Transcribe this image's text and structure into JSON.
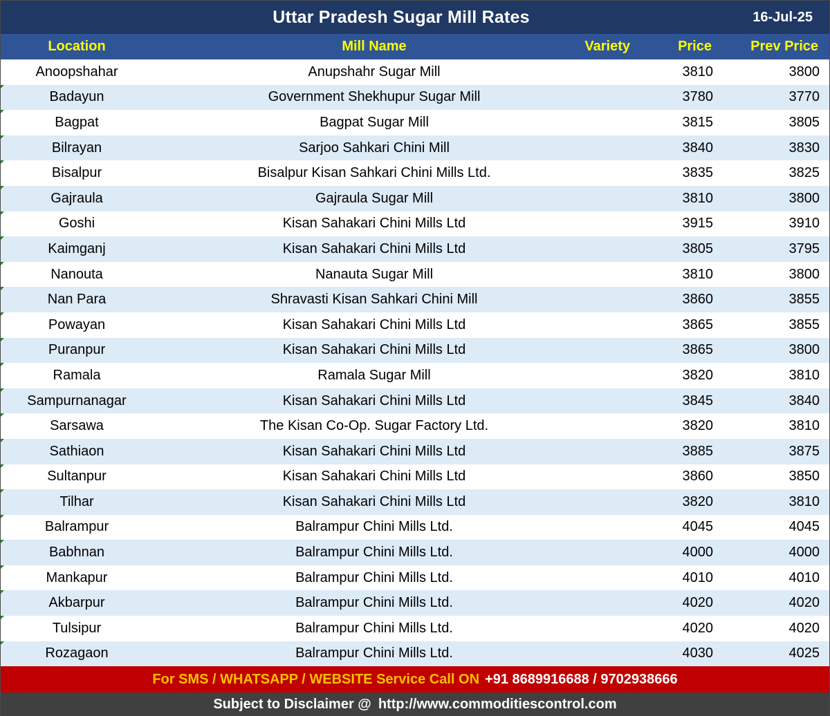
{
  "title": "Uttar Pradesh Sugar Mill Rates",
  "date": "16-Jul-25",
  "columns": {
    "location": "Location",
    "mill_name": "Mill Name",
    "variety": "Variety",
    "price": "Price",
    "prev_price": "Prev Price"
  },
  "rows": [
    {
      "location": "Anoopshahar",
      "mill": "Anupshahr Sugar Mill",
      "variety": "",
      "price": "3810",
      "prev": "3800"
    },
    {
      "location": "Badayun",
      "mill": "Government Shekhupur Sugar Mill",
      "variety": "",
      "price": "3780",
      "prev": "3770"
    },
    {
      "location": "Bagpat",
      "mill": "Bagpat Sugar Mill",
      "variety": "",
      "price": "3815",
      "prev": "3805"
    },
    {
      "location": "Bilrayan",
      "mill": "Sarjoo Sahkari Chini Mill",
      "variety": "",
      "price": "3840",
      "prev": "3830"
    },
    {
      "location": "Bisalpur",
      "mill": "Bisalpur Kisan Sahkari Chini Mills Ltd.",
      "variety": "",
      "price": "3835",
      "prev": "3825"
    },
    {
      "location": "Gajraula",
      "mill": "Gajraula Sugar Mill",
      "variety": "",
      "price": "3810",
      "prev": "3800"
    },
    {
      "location": "Goshi",
      "mill": "Kisan Sahakari Chini Mills Ltd",
      "variety": "",
      "price": "3915",
      "prev": "3910"
    },
    {
      "location": "Kaimganj",
      "mill": "Kisan Sahakari Chini Mills Ltd",
      "variety": "",
      "price": "3805",
      "prev": "3795"
    },
    {
      "location": "Nanouta",
      "mill": "Nanauta Sugar Mill",
      "variety": "",
      "price": "3810",
      "prev": "3800"
    },
    {
      "location": "Nan Para",
      "mill": "Shravasti Kisan Sahkari Chini Mill",
      "variety": "",
      "price": "3860",
      "prev": "3855"
    },
    {
      "location": "Powayan",
      "mill": "Kisan Sahakari Chini Mills Ltd",
      "variety": "",
      "price": "3865",
      "prev": "3855"
    },
    {
      "location": "Puranpur",
      "mill": "Kisan Sahakari Chini Mills Ltd",
      "variety": "",
      "price": "3865",
      "prev": "3800"
    },
    {
      "location": "Ramala",
      "mill": "Ramala Sugar Mill",
      "variety": "",
      "price": "3820",
      "prev": "3810"
    },
    {
      "location": "Sampurnanagar",
      "mill": "Kisan Sahakari Chini Mills Ltd",
      "variety": "",
      "price": "3845",
      "prev": "3840"
    },
    {
      "location": "Sarsawa",
      "mill": "The Kisan Co-Op. Sugar Factory Ltd.",
      "variety": "",
      "price": "3820",
      "prev": "3810"
    },
    {
      "location": "Sathiaon",
      "mill": "Kisan Sahakari Chini Mills Ltd",
      "variety": "",
      "price": "3885",
      "prev": "3875"
    },
    {
      "location": "Sultanpur",
      "mill": "Kisan Sahakari Chini Mills Ltd",
      "variety": "",
      "price": "3860",
      "prev": "3850"
    },
    {
      "location": "Tilhar",
      "mill": "Kisan Sahakari Chini Mills Ltd",
      "variety": "",
      "price": "3820",
      "prev": "3810"
    },
    {
      "location": "Balrampur",
      "mill": "Balrampur Chini Mills Ltd.",
      "variety": "",
      "price": "4045",
      "prev": "4045"
    },
    {
      "location": "Babhnan",
      "mill": "Balrampur Chini Mills Ltd.",
      "variety": "",
      "price": "4000",
      "prev": "4000"
    },
    {
      "location": "Mankapur",
      "mill": "Balrampur Chini Mills Ltd.",
      "variety": "",
      "price": "4010",
      "prev": "4010"
    },
    {
      "location": "Akbarpur",
      "mill": "Balrampur Chini Mills Ltd.",
      "variety": "",
      "price": "4020",
      "prev": "4020"
    },
    {
      "location": "Tulsipur",
      "mill": "Balrampur Chini Mills Ltd.",
      "variety": "",
      "price": "4020",
      "prev": "4020"
    },
    {
      "location": "Rozagaon",
      "mill": "Balrampur Chini Mills Ltd.",
      "variety": "",
      "price": "4030",
      "prev": "4025"
    }
  ],
  "footer": {
    "service_text": "For SMS / WHATSAPP / WEBSITE Service Call  ON",
    "phone": "+91 8689916688 / 9702938666",
    "disclaimer": "Subject to Disclaimer @",
    "url": "http://www.commoditiescontrol.com"
  },
  "colors": {
    "title_bg": "#1f3864",
    "header_bg": "#2f5597",
    "header_text": "#ffff00",
    "row_alt": "#ddebf7",
    "footer_red": "#c00000",
    "footer_text": "#ffc000",
    "footer_gray": "#404040"
  }
}
